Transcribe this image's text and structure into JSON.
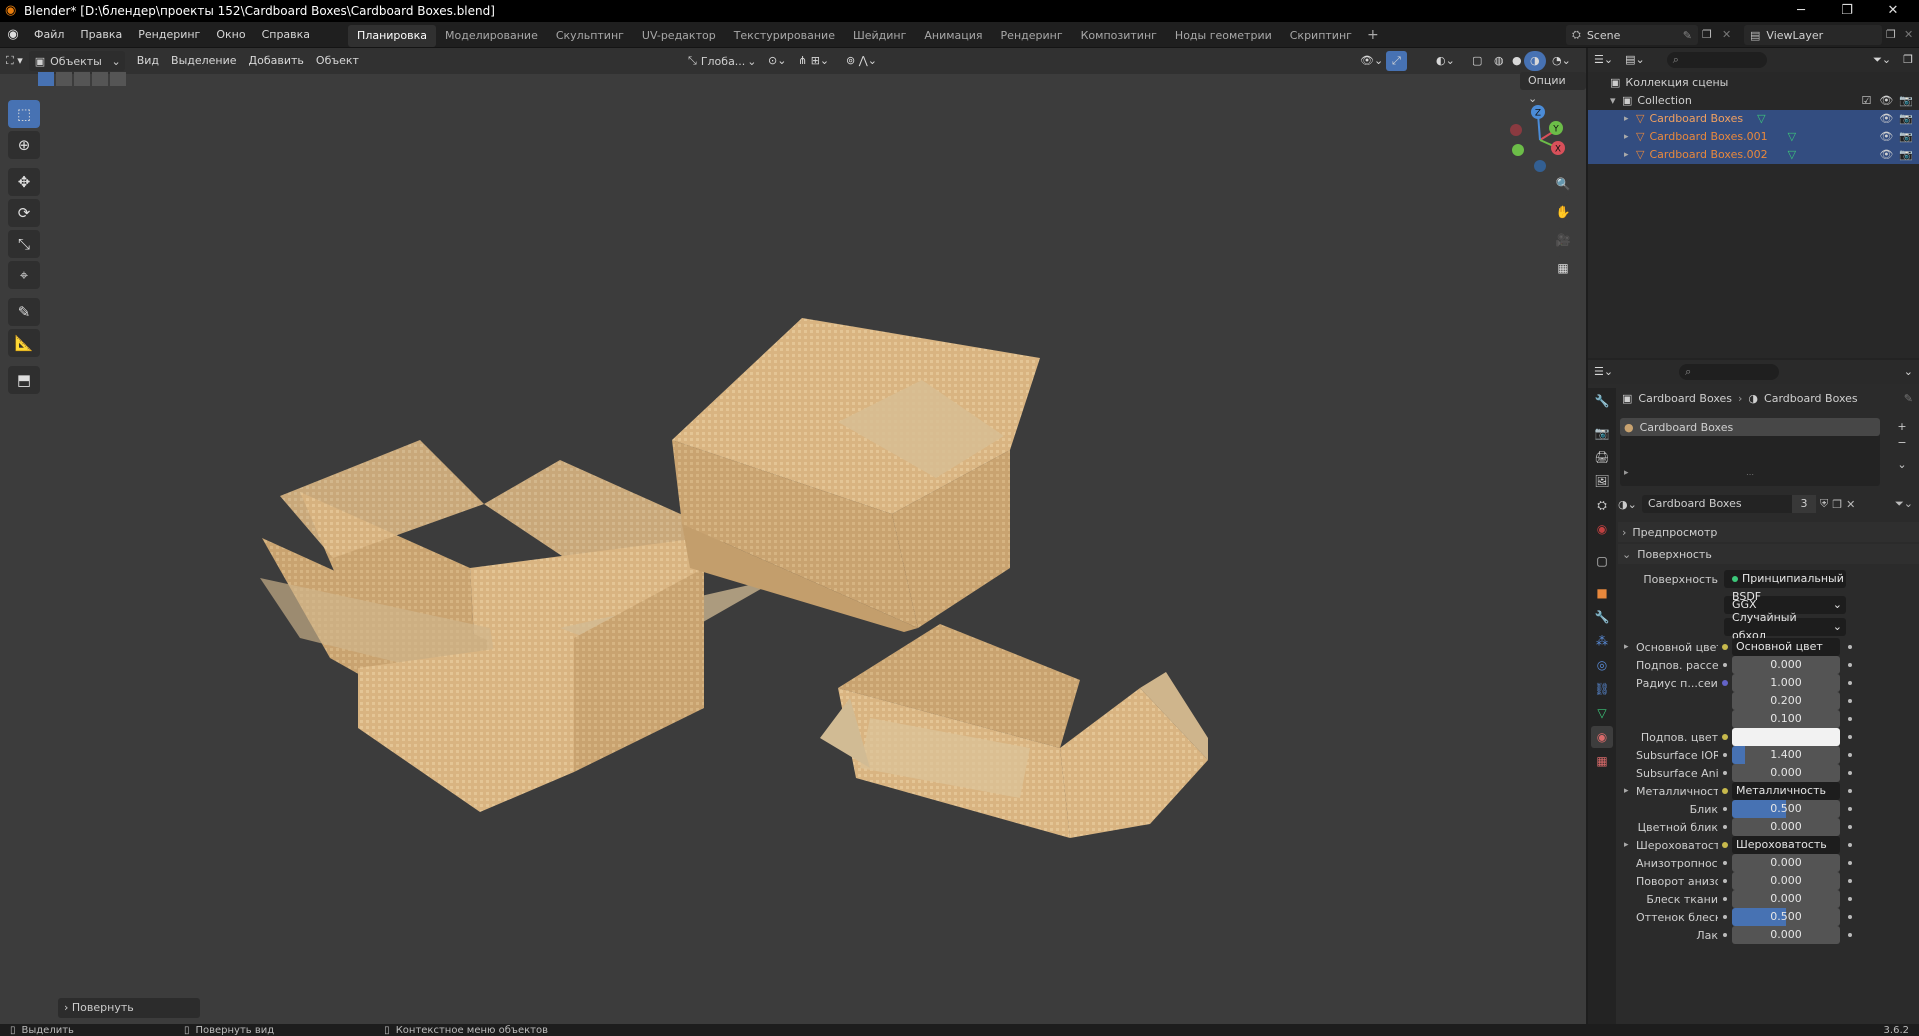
{
  "title": "Blender* [D:\\блендер\\проекты 152\\Cardboard Boxes\\Cardboard Boxes.blend]",
  "menus": [
    "Файл",
    "Правка",
    "Рендеринг",
    "Окно",
    "Справка"
  ],
  "workspaces": [
    "Планировка",
    "Моделирование",
    "Скульптинг",
    "UV-редактор",
    "Текстурирование",
    "Шейдинг",
    "Анимация",
    "Рендеринг",
    "Композитинг",
    "Ноды геометрии",
    "Скриптинг"
  ],
  "active_workspace": "Планировка",
  "scene": "Scene",
  "view_layer": "ViewLayer",
  "viewport": {
    "mode": "Объекты",
    "menus": [
      "Вид",
      "Выделение",
      "Добавить",
      "Объект"
    ],
    "transform": "Глоба...",
    "options": "Опции",
    "last_op": "Повернуть"
  },
  "gizmo": {
    "x": "X",
    "y": "Y",
    "z": "Z"
  },
  "outliner": {
    "root": "Коллекция сцены",
    "collection": "Collection",
    "objects": [
      "Cardboard Boxes",
      "Cardboard Boxes.001",
      "Cardboard Boxes.002"
    ]
  },
  "props": {
    "breadcrumb_obj": "Cardboard Boxes",
    "breadcrumb_mat": "Cardboard Boxes",
    "slot": "Cardboard Boxes",
    "material_name": "Cardboard Boxes",
    "users": "3",
    "preview": "Предпросмотр",
    "surface_panel": "Поверхность",
    "surface_label": "Поверхность",
    "surface_value": "Принципиальный BSDF",
    "distribution": "GGX",
    "sss_method": "Случайный обход",
    "rows": [
      {
        "label": "Основной цвет",
        "value": "Основной цвет",
        "type": "link",
        "expand": true
      },
      {
        "label": "Подпов. рассеива...",
        "value": "0.000",
        "type": "num",
        "dot": "g"
      },
      {
        "label": "Радиус п...сеивания",
        "value": "1.000",
        "type": "num",
        "dot": "p"
      },
      {
        "label": "",
        "value": "0.200",
        "type": "num",
        "dot": "none"
      },
      {
        "label": "",
        "value": "0.100",
        "type": "num",
        "dot": "none"
      },
      {
        "label": "Подпов. цвет",
        "value": "",
        "type": "color",
        "dot": "y"
      },
      {
        "label": "Subsurface IOR",
        "value": "1.400",
        "type": "num",
        "dot": "g",
        "fill": 0.12
      },
      {
        "label": "Subsurface Anisotr...",
        "value": "0.000",
        "type": "num",
        "dot": "g"
      },
      {
        "label": "Металличность",
        "value": "Металличность",
        "type": "link",
        "expand": true
      },
      {
        "label": "Блик",
        "value": "0.500",
        "type": "num",
        "dot": "g",
        "fill": 0.5
      },
      {
        "label": "Цветной блик",
        "value": "0.000",
        "type": "num",
        "dot": "g"
      },
      {
        "label": "Шероховатость",
        "value": "Шероховатость",
        "type": "link",
        "expand": true
      },
      {
        "label": "Анизотропность",
        "value": "0.000",
        "type": "num",
        "dot": "g"
      },
      {
        "label": "Поворот анизотро...",
        "value": "0.000",
        "type": "num",
        "dot": "g"
      },
      {
        "label": "Блеск ткани",
        "value": "0.000",
        "type": "num",
        "dot": "g"
      },
      {
        "label": "Оттенок блеска тк...",
        "value": "0.500",
        "type": "num",
        "dot": "g",
        "fill": 0.5
      },
      {
        "label": "Лак",
        "value": "0.000",
        "type": "num",
        "dot": "g"
      }
    ]
  },
  "status": {
    "select": "Выделить",
    "rotate_view": "Повернуть вид",
    "context": "Контекстное меню объектов",
    "version": "3.6.2"
  },
  "colors": {
    "accent": "#4772b3",
    "selected_row": "#334d80",
    "object_text": "#e8883c",
    "viewport": "#3c3c3c"
  }
}
